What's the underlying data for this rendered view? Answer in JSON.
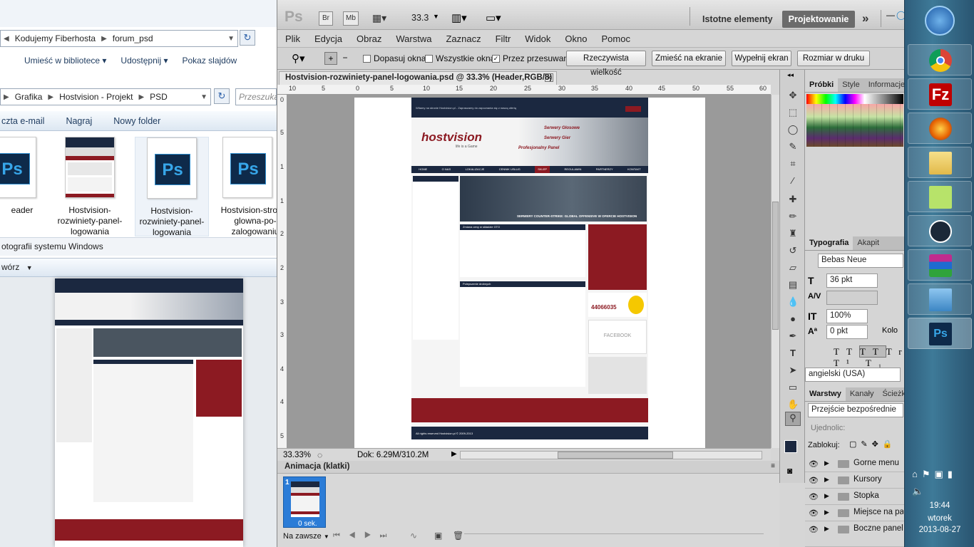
{
  "explorer": {
    "breadcrumb_top": [
      "Kodujemy Fiberhosta",
      "forum_psd"
    ],
    "menu": [
      "Umieść w bibliotece ▾",
      "Udostępnij ▾",
      "Pokaz slajdów"
    ],
    "breadcrumb_second": [
      "Grafika",
      "Hostvision - Projekt",
      "PSD"
    ],
    "search_placeholder": "Przeszuka",
    "toolbar": [
      "czta e-mail",
      "Nagraj",
      "Nowy folder"
    ],
    "files": [
      {
        "name": "eader"
      },
      {
        "name": "Hostvision-rozwiniety-panel-logowania"
      },
      {
        "name": "Hostvision-rozwiniety-panel-logowania"
      },
      {
        "name": "Hostvision-strona-glowna-po-zalogowaniu"
      }
    ],
    "status_text": "otografii systemu Windows",
    "organize_label": "wórz"
  },
  "photoshop": {
    "logo": "Ps",
    "mini_buttons": [
      "Br",
      "Mb"
    ],
    "zoom_select": "33.3",
    "workspace_label": "Istotne elementy",
    "workspace_active": "Projektowanie",
    "menu": [
      "Plik",
      "Edycja",
      "Obraz",
      "Warstwa",
      "Zaznacz",
      "Filtr",
      "Widok",
      "Okno",
      "Pomoc"
    ],
    "options": {
      "chk_dopasuj": "Dopasuj okna",
      "chk_wszystkie": "Wszystkie okna",
      "chk_przesuwanie": "Przez przesuwanie",
      "btn_rzeczywista": "Rzeczywista wielkość",
      "btn_zmiesc": "Zmieść na ekranie",
      "btn_wypelnij": "Wypełnij ekran",
      "btn_druku": "Rozmiar w druku"
    },
    "document_tab": "Hostvision-rozwiniety-panel-logowania.psd @ 33.3% (Header,RGB/8)",
    "ruler_h": [
      "10",
      "5",
      "0",
      "5",
      "10",
      "15",
      "20",
      "25",
      "30",
      "35",
      "40",
      "45",
      "50",
      "55",
      "60"
    ],
    "ruler_v": [
      "0",
      "5",
      "1",
      "1",
      "2",
      "2",
      "3",
      "3",
      "4",
      "4",
      "5"
    ],
    "status_zoom": "33.33%",
    "status_doc": "Dok: 6.29M/310.2M",
    "anim_title": "Animacja (klatki)",
    "frame_number": "1",
    "frame_delay": "0 sek.",
    "loop_label": "Na zawsze",
    "panels": {
      "swatches_tabs": [
        "Próbki",
        "Style",
        "Informacje"
      ],
      "type_tabs": [
        "Typografia",
        "Akapit"
      ],
      "font_name": "Bebas Neue",
      "font_size": "36 pkt",
      "leading": "",
      "scale": "100%",
      "tracking": "0 pkt",
      "color_label": "Kolo",
      "language": "angielski (USA)",
      "layers_tabs": [
        "Warstwy",
        "Kanały",
        "Ścieżk"
      ],
      "blend_mode": "Przejście bezpośrednie",
      "opacity_label": "Ujednolic:",
      "lock_label": "Zablokuj:",
      "layers": [
        "Gorne menu",
        "Kursory",
        "Stopka",
        "Miejsce na par",
        "Boczne panele"
      ]
    },
    "site": {
      "welcome": "Witamy na stronie Hostvision.pl - Zapraszamy do zapoznania się z naszą ofertą",
      "logo": "hostvision",
      "tagline": "life is a Game",
      "slogans": [
        "Serwery Głosowe",
        "Serwery Gier",
        "Profesjonalny Panel"
      ],
      "nav": [
        "HOME",
        "O NAS",
        "LOKALIZACJE",
        "CENNIK USŁUG",
        "SKLEP",
        "REGULAMIN",
        "PARTNERZY",
        "KONTAKT"
      ],
      "banner_text": "SERWERY COUNTER-STRIKE: GLOBAL OFFENSIVE W OFERCIE HOSTVISION",
      "news_titles": [
        "Zmiana ceny w składzie GTO",
        "Polepszenie drobnych"
      ],
      "phone": "44066035",
      "facebook": "FACEBOOK",
      "footer": "All rights reserved Hostvision.pl © 2009-2013"
    }
  },
  "taskbar": {
    "time": "19:44",
    "day": "wtorek",
    "date": "2013-08-27"
  },
  "colors": {
    "ps_accent": "#2b7cd7",
    "site_dark": "#1b2840",
    "site_red": "#8c1a22"
  }
}
